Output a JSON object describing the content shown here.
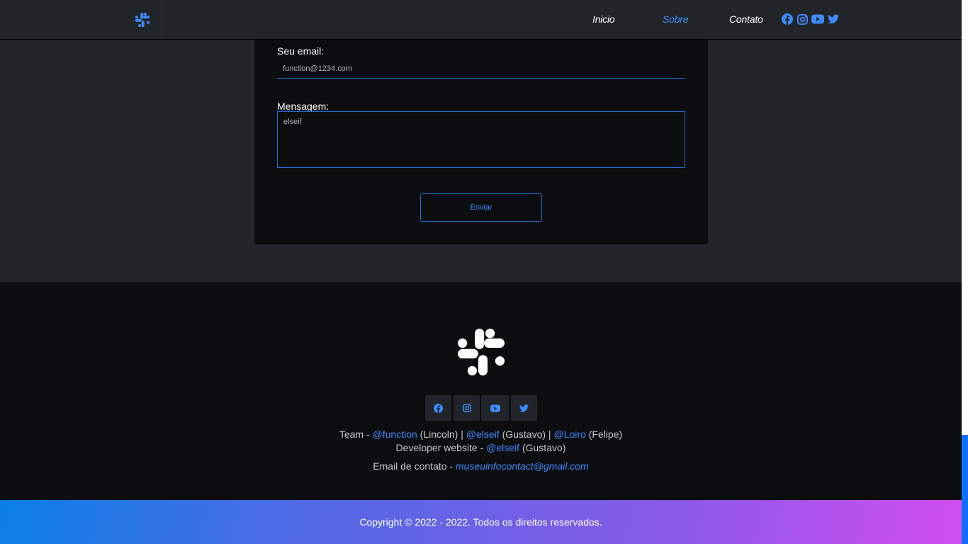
{
  "nav": {
    "logo_icon": "slack-icon",
    "links": [
      {
        "label": "Inicio"
      },
      {
        "label": "Sobre",
        "active": true
      },
      {
        "label": "Contato"
      }
    ],
    "social_icons": [
      "facebook-icon",
      "instagram-icon",
      "youtube-icon",
      "twitter-icon"
    ]
  },
  "form": {
    "email_label": "Seu email:",
    "email_value": "function@1234.com",
    "message_label": "Mensagem:",
    "message_value": "elseif",
    "send_label": "Enviar"
  },
  "footer": {
    "logo_icon": "slack-icon",
    "social_icons": [
      "facebook-icon",
      "instagram-icon",
      "youtube-icon",
      "twitter-icon"
    ],
    "team": {
      "prefix": "Team - ",
      "members": [
        {
          "handle": "@function",
          "name": " (Lincoln)"
        },
        {
          "handle": "@elseif",
          "name": " (Gustavo)"
        },
        {
          "handle": "@Loiro",
          "name": " (Felipe)"
        }
      ],
      "separator": " | "
    },
    "developer": {
      "prefix": "Developer website - ",
      "handle": "@elseif",
      "name": " (Gustavo)"
    },
    "contact": {
      "prefix": "Email de contato - ",
      "email": "museuinfocontact@gmail.com"
    },
    "copyright": "Copyright © 2022 - 2022. Todos os direitos reservados."
  },
  "colors": {
    "accent": "#3d8bfd",
    "background": "#212529",
    "card": "#0b0d0f"
  }
}
